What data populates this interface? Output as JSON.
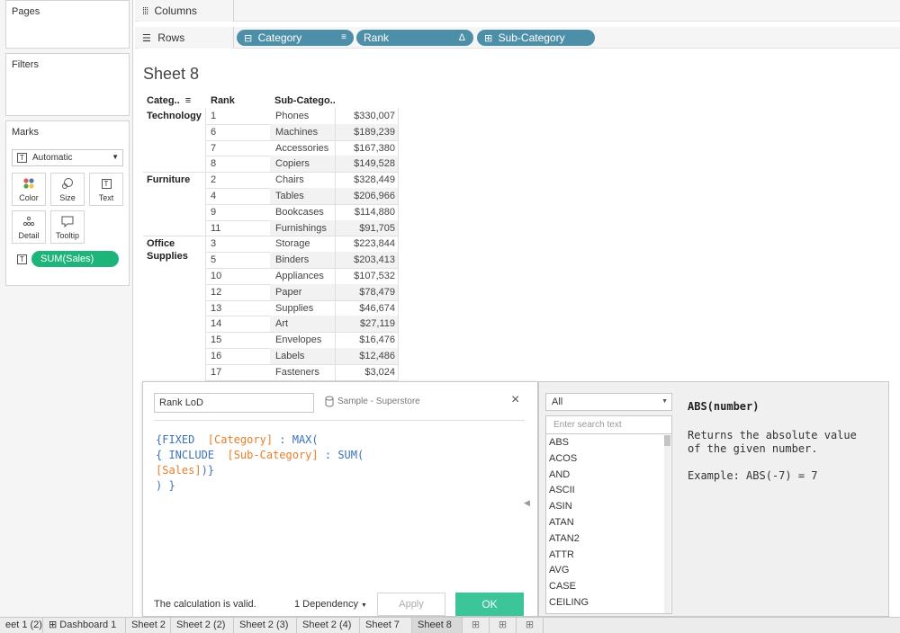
{
  "left_panel": {
    "pages_title": "Pages",
    "filters_title": "Filters",
    "marks_title": "Marks",
    "marks_type": "Automatic",
    "buttons": [
      {
        "label": "Color"
      },
      {
        "label": "Size"
      },
      {
        "label": "Text"
      },
      {
        "label": "Detail"
      },
      {
        "label": "Tooltip"
      }
    ],
    "measure_pill": "SUM(Sales)"
  },
  "shelves": {
    "columns_label": "Columns",
    "rows_label": "Rows",
    "row_pills": [
      "Category",
      "Rank",
      "Sub-Category"
    ]
  },
  "sheet": {
    "title": "Sheet 8",
    "headers": {
      "category": "Categ..",
      "rank": "Rank",
      "subcategory": "Sub-Catego.."
    },
    "groups": [
      {
        "category": "Technology",
        "rows": [
          {
            "rank": "1",
            "sub": "Phones",
            "value": "$330,007"
          },
          {
            "rank": "6",
            "sub": "Machines",
            "value": "$189,239"
          },
          {
            "rank": "7",
            "sub": "Accessories",
            "value": "$167,380"
          },
          {
            "rank": "8",
            "sub": "Copiers",
            "value": "$149,528"
          }
        ]
      },
      {
        "category": "Furniture",
        "rows": [
          {
            "rank": "2",
            "sub": "Chairs",
            "value": "$328,449"
          },
          {
            "rank": "4",
            "sub": "Tables",
            "value": "$206,966"
          },
          {
            "rank": "9",
            "sub": "Bookcases",
            "value": "$114,880"
          },
          {
            "rank": "11",
            "sub": "Furnishings",
            "value": "$91,705"
          }
        ]
      },
      {
        "category": "Office Supplies",
        "category_lines": [
          "Office",
          "Supplies"
        ],
        "rows": [
          {
            "rank": "3",
            "sub": "Storage",
            "value": "$223,844"
          },
          {
            "rank": "5",
            "sub": "Binders",
            "value": "$203,413"
          },
          {
            "rank": "10",
            "sub": "Appliances",
            "value": "$107,532"
          },
          {
            "rank": "12",
            "sub": "Paper",
            "value": "$78,479"
          },
          {
            "rank": "13",
            "sub": "Supplies",
            "value": "$46,674"
          },
          {
            "rank": "14",
            "sub": "Art",
            "value": "$27,119"
          },
          {
            "rank": "15",
            "sub": "Envelopes",
            "value": "$16,476"
          },
          {
            "rank": "16",
            "sub": "Labels",
            "value": "$12,486"
          },
          {
            "rank": "17",
            "sub": "Fasteners",
            "value": "$3,024"
          }
        ]
      }
    ]
  },
  "calc_dialog": {
    "name_value": "Rank LoD",
    "datasource": "Sample - Superstore",
    "code_lines": [
      [
        {
          "t": "{FIXED  "
        },
        {
          "t": "[Category]",
          "f": true
        },
        {
          "t": " : MAX("
        }
      ],
      [
        {
          "t": "{ INCLUDE  "
        },
        {
          "t": "[Sub-Category]",
          "f": true
        },
        {
          "t": " : SUM("
        }
      ],
      [
        {
          "t": "[Sales]",
          "f": true
        },
        {
          "t": ")}"
        }
      ],
      [
        {
          "t": ") }"
        }
      ]
    ],
    "status": "The calculation is valid.",
    "dependency": "1 Dependency",
    "apply_label": "Apply",
    "ok_label": "OK"
  },
  "functions_panel": {
    "filter_value": "All",
    "search_placeholder": "Enter search text",
    "functions": [
      "ABS",
      "ACOS",
      "AND",
      "ASCII",
      "ASIN",
      "ATAN",
      "ATAN2",
      "ATTR",
      "AVG",
      "CASE",
      "CEILING"
    ],
    "doc_title": "ABS(number)",
    "doc_lines": [
      "Returns the absolute value",
      "of the given number."
    ],
    "doc_example": "Example: ABS(-7) = 7"
  },
  "tabs": [
    {
      "label": "eet 1 (2)"
    },
    {
      "label": "Dashboard 1",
      "icon": true
    },
    {
      "label": "Sheet 2"
    },
    {
      "label": "Sheet 2 (2)"
    },
    {
      "label": "Sheet 2 (3)"
    },
    {
      "label": "Sheet 2 (4)"
    },
    {
      "label": "Sheet 7"
    },
    {
      "label": "Sheet 8",
      "active": true
    }
  ],
  "colors": {
    "accent_teal": "#4d8fa9",
    "measure_green": "#1fb57a",
    "ok_green": "#3cc598",
    "field_orange": "#e87e28",
    "code_blue": "#3a73b3"
  }
}
